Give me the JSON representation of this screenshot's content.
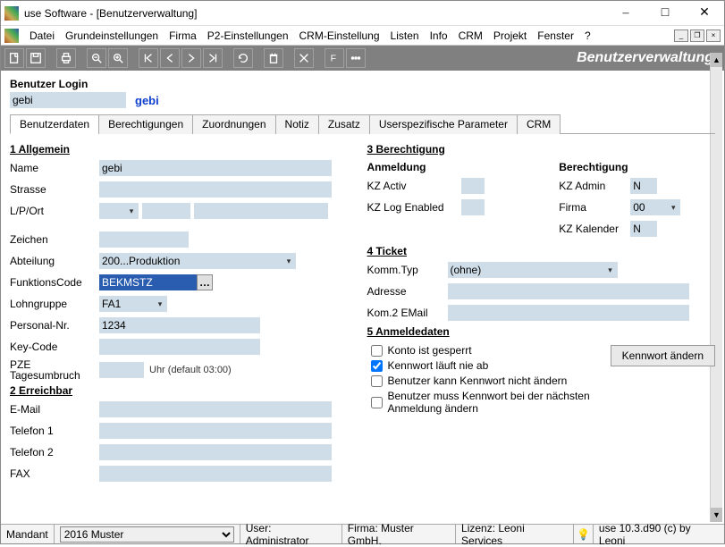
{
  "window": {
    "title": "use Software - [Benutzerverwaltung]"
  },
  "menu": [
    "Datei",
    "Grundeinstellungen",
    "Firma",
    "P2-Einstellungen",
    "CRM-Einstellung",
    "Listen",
    "Info",
    "CRM",
    "Projekt",
    "Fenster",
    "?"
  ],
  "toolbar_title": "Benutzerverwaltung",
  "login": {
    "heading": "Benutzer Login",
    "value": "gebi",
    "display": "gebi"
  },
  "tabs": [
    "Benutzerdaten",
    "Berechtigungen",
    "Zuordnungen",
    "Notiz",
    "Zusatz",
    "Userspezifische Parameter",
    "CRM"
  ],
  "g1": {
    "title": "1 Allgemein",
    "name_lbl": "Name",
    "name_val": "gebi",
    "strasse_lbl": "Strasse",
    "strasse_val": "",
    "lport_lbl": "L/P/Ort",
    "zeichen_lbl": "Zeichen",
    "zeichen_val": "",
    "abteilung_lbl": "Abteilung",
    "abteilung_val": "200...Produktion",
    "funktion_lbl": "FunktionsCode",
    "funktion_val": "BEKMSTZ",
    "lohn_lbl": "Lohngruppe",
    "lohn_val": "FA1",
    "pnr_lbl": "Personal-Nr.",
    "pnr_val": "1234",
    "key_lbl": "Key-Code",
    "key_val": "",
    "pze_lbl": "PZE Tagesumbruch",
    "pze_val": "",
    "pze_hint": "Uhr (default 03:00)"
  },
  "g2": {
    "title": "2 Erreichbar",
    "email_lbl": "E-Mail",
    "email_val": "",
    "tel1_lbl": "Telefon 1",
    "tel1_val": "",
    "tel2_lbl": "Telefon 2",
    "tel2_val": "",
    "fax_lbl": "FAX",
    "fax_val": ""
  },
  "g3": {
    "title": "3 Berechtigung",
    "anm": "Anmeldung",
    "ber": "Berechtigung",
    "kzactiv_lbl": "KZ Activ",
    "kzlog_lbl": "KZ Log Enabled",
    "kzadmin_lbl": "KZ Admin",
    "kzadmin_val": "N",
    "firma_lbl": "Firma",
    "firma_val": "00",
    "kzkal_lbl": "KZ Kalender",
    "kzkal_val": "N"
  },
  "g4": {
    "title": "4 Ticket",
    "komm_lbl": "Komm.Typ",
    "komm_val": "(ohne)",
    "adr_lbl": "Adresse",
    "adr_val": "",
    "kom2_lbl": "Kom.2 EMail",
    "kom2_val": ""
  },
  "g5": {
    "title": "5 Anmeldedaten",
    "c1": "Konto ist gesperrt",
    "c2": "Kennwort läuft nie ab",
    "c3": "Benutzer kann Kennwort nicht ändern",
    "c4": "Benutzer muss Kennwort bei der nächsten Anmeldung ändern",
    "btn": "Kennwort ändern"
  },
  "status": {
    "mandant_lbl": "Mandant",
    "mandant_val": "2016 Muster",
    "user": "User: Administrator",
    "firma": "Firma: Muster GmbH.",
    "lizenz": "Lizenz: Leoni Services",
    "ver": "use 10.3.d90 (c) by Leoni"
  }
}
